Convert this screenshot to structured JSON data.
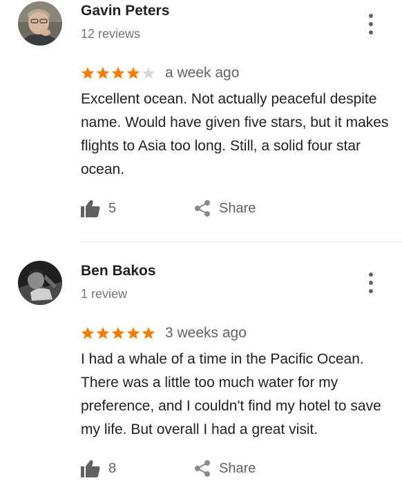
{
  "reviews": [
    {
      "author": "Gavin Peters",
      "review_count": "12 reviews",
      "rating": 4,
      "rating_max": 5,
      "time_ago": "a week ago",
      "text": "Excellent ocean. Not actually peaceful despite name. Would have given five stars, but it makes flights to Asia too long. Still, a solid four star ocean.",
      "likes": "5",
      "share_label": "Share"
    },
    {
      "author": "Ben Bakos",
      "review_count": "1 review",
      "rating": 5,
      "rating_max": 5,
      "time_ago": "3 weeks ago",
      "text": "I had a whale of a time in the Pacific Ocean. There was a little too much water for my preference, and I couldn't find my hotel to save my life. But overall I had a great visit.",
      "likes": "8",
      "share_label": "Share"
    }
  ],
  "colors": {
    "star_on": "#f57c00",
    "star_off": "#d8d8d8",
    "secondary_text": "#757575",
    "icon_gray": "#616161"
  },
  "icons": {
    "menu": "more-vert-icon",
    "like": "thumb-up-icon",
    "share": "share-icon"
  }
}
